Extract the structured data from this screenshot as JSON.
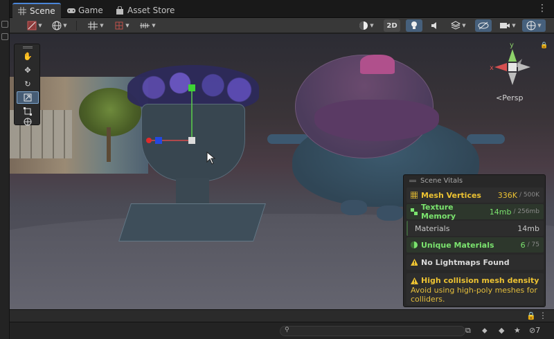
{
  "tabs": [
    {
      "label": "Scene",
      "icon": "grid-icon",
      "active": true
    },
    {
      "label": "Game",
      "icon": "gamepad-icon",
      "active": false
    },
    {
      "label": "Asset Store",
      "icon": "bag-icon",
      "active": false
    }
  ],
  "toolbar": {
    "mode_2d_label": "2D"
  },
  "orientation": {
    "persp_label": "Persp",
    "axis_x": "x",
    "axis_y": "y"
  },
  "vitals": {
    "title": "Scene Vitals",
    "mesh_vertices": {
      "label": "Mesh Vertices",
      "value": "336K",
      "limit": "/ 500K"
    },
    "texture_memory": {
      "label": "Texture Memory",
      "value": "14mb",
      "limit": "/ 256mb"
    },
    "materials": {
      "label": "Materials",
      "value": "14mb"
    },
    "unique_materials": {
      "label": "Unique Materials",
      "value": "6",
      "limit": "/ 75"
    },
    "warning_lightmaps": "No Lightmaps Found",
    "warning_collision_title": "High collision mesh density",
    "warning_collision_desc": "Avoid using high-poly meshes for colliders."
  },
  "status": {
    "hidden_count": "7"
  },
  "colors": {
    "accent": "#4a85d8",
    "warning": "#ecc232",
    "good": "#7be36e"
  }
}
